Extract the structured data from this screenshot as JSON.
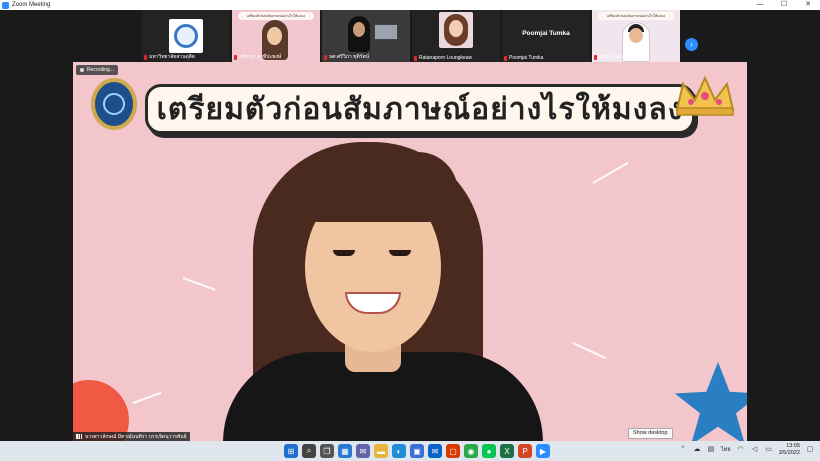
{
  "window": {
    "title": "Zoom Meeting",
    "controls": [
      "—",
      "☐",
      "✕"
    ]
  },
  "thumbnails": [
    {
      "name": "มหาวิทยาลัยสวนดุสิต",
      "type": "logo"
    },
    {
      "name": "อภิชญา สาทีปะพงษ์",
      "type": "video",
      "banner": "เตรียมตัวก่อนสัมภาษณ์อย่างไรให้มงลง"
    },
    {
      "name": "นศ.ศรีวิภา ชุติรัตน์",
      "type": "video"
    },
    {
      "name": "Ratanaporn Loungkeaw",
      "type": "photo"
    },
    {
      "name": "Poomjai Tumka",
      "type": "name-only"
    },
    {
      "name": "ณัฐฐา ทองคำเจริญ",
      "type": "video",
      "banner": "เตรียมตัวก่อนสัมภาษณ์อย่างไรให้มงลง"
    }
  ],
  "next_page_icon": "chevron-right-icon",
  "stage": {
    "recording_label": "Recording...",
    "slide_title": "เตรียมตัวก่อนสัมภาษณ์อย่างไรให้มงลง",
    "speaker_name": "นางสาวลักษณ์ มีตาณ์นนทิรา บรรเจิดนุวารพันธ์"
  },
  "tooltip": "Show desktop",
  "taskbar": {
    "apps": [
      {
        "icon": "windows-start-icon",
        "color": "#1f6fd1"
      },
      {
        "icon": "search-icon",
        "color": "#444444"
      },
      {
        "icon": "task-view-icon",
        "color": "#555555"
      },
      {
        "icon": "widgets-icon",
        "color": "#2b78d4"
      },
      {
        "icon": "chat-icon",
        "color": "#6264a7"
      },
      {
        "icon": "file-explorer-icon",
        "color": "#e8b43a"
      },
      {
        "icon": "edge-icon",
        "color": "#1f8ed6"
      },
      {
        "icon": "store-icon",
        "color": "#3a6fd6"
      },
      {
        "icon": "mail-icon",
        "color": "#0a64c8"
      },
      {
        "icon": "office-icon",
        "color": "#d83b01"
      },
      {
        "icon": "chrome-icon",
        "color": "#2aa84a"
      },
      {
        "icon": "line-icon",
        "color": "#06c755"
      },
      {
        "icon": "excel-icon",
        "color": "#1d7044"
      },
      {
        "icon": "powerpoint-icon",
        "color": "#d24726"
      },
      {
        "icon": "zoom-icon",
        "color": "#2d8cff"
      }
    ],
    "tray": {
      "language": "ไทย",
      "time": "13:05",
      "date": "3/5/2022"
    }
  }
}
